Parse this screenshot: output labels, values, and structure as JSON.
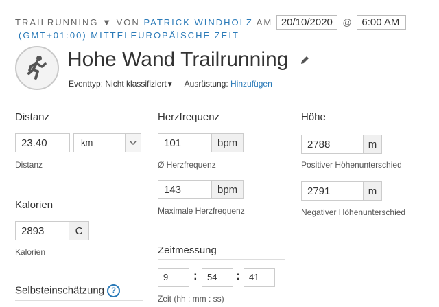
{
  "header": {
    "sport": "TRAILRUNNING",
    "sport_caret": "▼",
    "von": "VON",
    "user": "PATRICK WINDHOLZ",
    "am": "AM",
    "date": "20/10/2020",
    "at_symbol": "@",
    "time": "6:00 AM",
    "timezone": "(GMT+01:00) MITTELEUROPÄISCHE ZEIT",
    "title": "Hohe Wand Trailrunning",
    "event_type_label": "Eventtyp: Nicht klassifiziert",
    "event_type_caret": "▼",
    "equipment_label": "Ausrüstung:",
    "equipment_link": "Hinzufügen"
  },
  "distance": {
    "section": "Distanz",
    "value": "23.40",
    "unit_selected": "km",
    "caption": "Distanz"
  },
  "calories": {
    "section": "Kalorien",
    "value": "2893",
    "unit": "C",
    "caption": "Kalorien"
  },
  "self_assessment": {
    "section": "Selbsteinschätzung",
    "help": "?"
  },
  "heart_rate": {
    "section": "Herzfrequenz",
    "avg_value": "101",
    "avg_unit": "bpm",
    "avg_caption": "Ø Herzfrequenz",
    "max_value": "143",
    "max_unit": "bpm",
    "max_caption": "Maximale Herzfrequenz"
  },
  "timing": {
    "section": "Zeitmessung",
    "hours": "9",
    "minutes": "54",
    "seconds": "41",
    "separator": ":",
    "caption": "Zeit (hh : mm : ss)"
  },
  "elevation": {
    "section": "Höhe",
    "gain_value": "2788",
    "gain_unit": "m",
    "gain_caption": "Positiver Höhenunterschied",
    "loss_value": "2791",
    "loss_unit": "m",
    "loss_caption": "Negativer Höhenunterschied"
  },
  "icons": {
    "activity": "runner-icon",
    "edit": "pencil-icon",
    "dropdown": "chevron-down-icon",
    "help": "question-circle-icon"
  },
  "colors": {
    "link": "#2a7ab8",
    "text": "#333333",
    "unit_bg": "#f0f0f0"
  }
}
